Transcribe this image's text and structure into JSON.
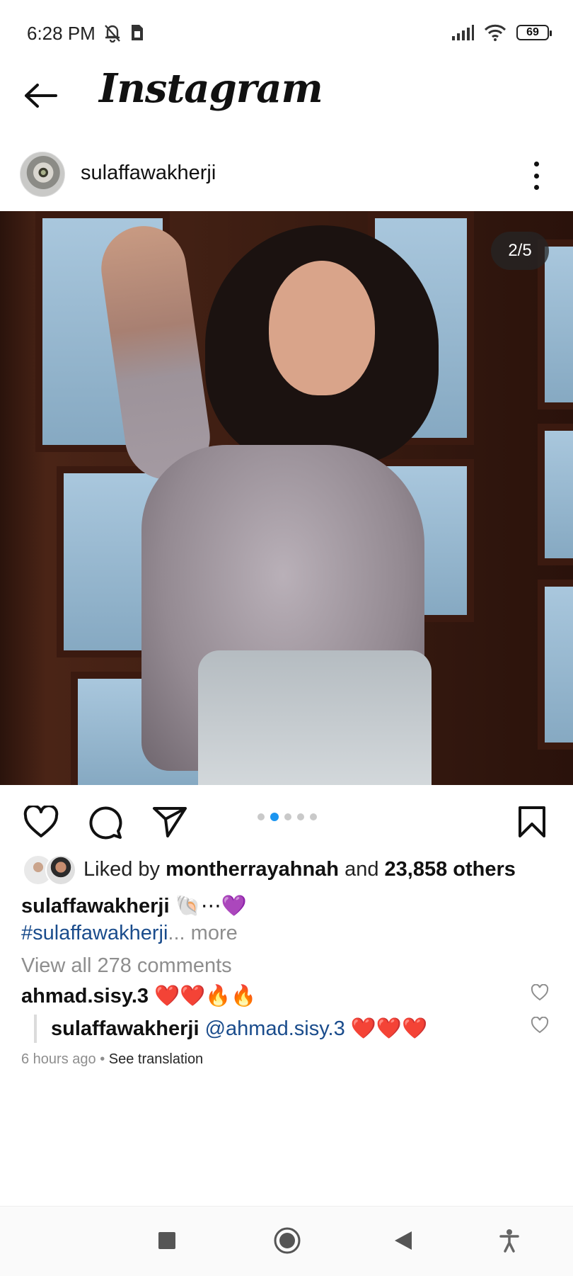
{
  "status_bar": {
    "time": "6:28 PM",
    "battery": "69",
    "icons": [
      "muted-bell-icon",
      "sim-icon",
      "signal-icon",
      "wifi-icon",
      "battery-icon"
    ]
  },
  "header": {
    "logo_text": "Instagram",
    "back_icon": "arrow-left-icon"
  },
  "post": {
    "username": "sulaffawakherji",
    "image_counter": "2/5",
    "carousel": {
      "total": 5,
      "active_index": 1
    },
    "likes": {
      "prefix": "Liked by",
      "liker": "montherrayahnah",
      "conjunction": "and",
      "others": "23,858 others"
    },
    "caption": {
      "username": "sulaffawakherji",
      "text": "🐚⋯💜",
      "hashtag": "#sulaffawakherji",
      "ellipsis": "...",
      "more": "more"
    },
    "view_all_comments": "View all 278 comments",
    "comments": [
      {
        "username": "ahmad.sisy.3",
        "text": "❤️❤️🔥🔥"
      },
      {
        "username": "sulaffawakherji",
        "mention": "@ahmad.sisy.3",
        "text": "❤️❤️❤️"
      }
    ],
    "timestamp": "6 hours ago",
    "separator": " • ",
    "see_translation": "See translation"
  },
  "colors": {
    "accent_blue": "#1c95f0",
    "link_blue": "#1a4c8c",
    "muted_gray": "#8e8e8e"
  }
}
